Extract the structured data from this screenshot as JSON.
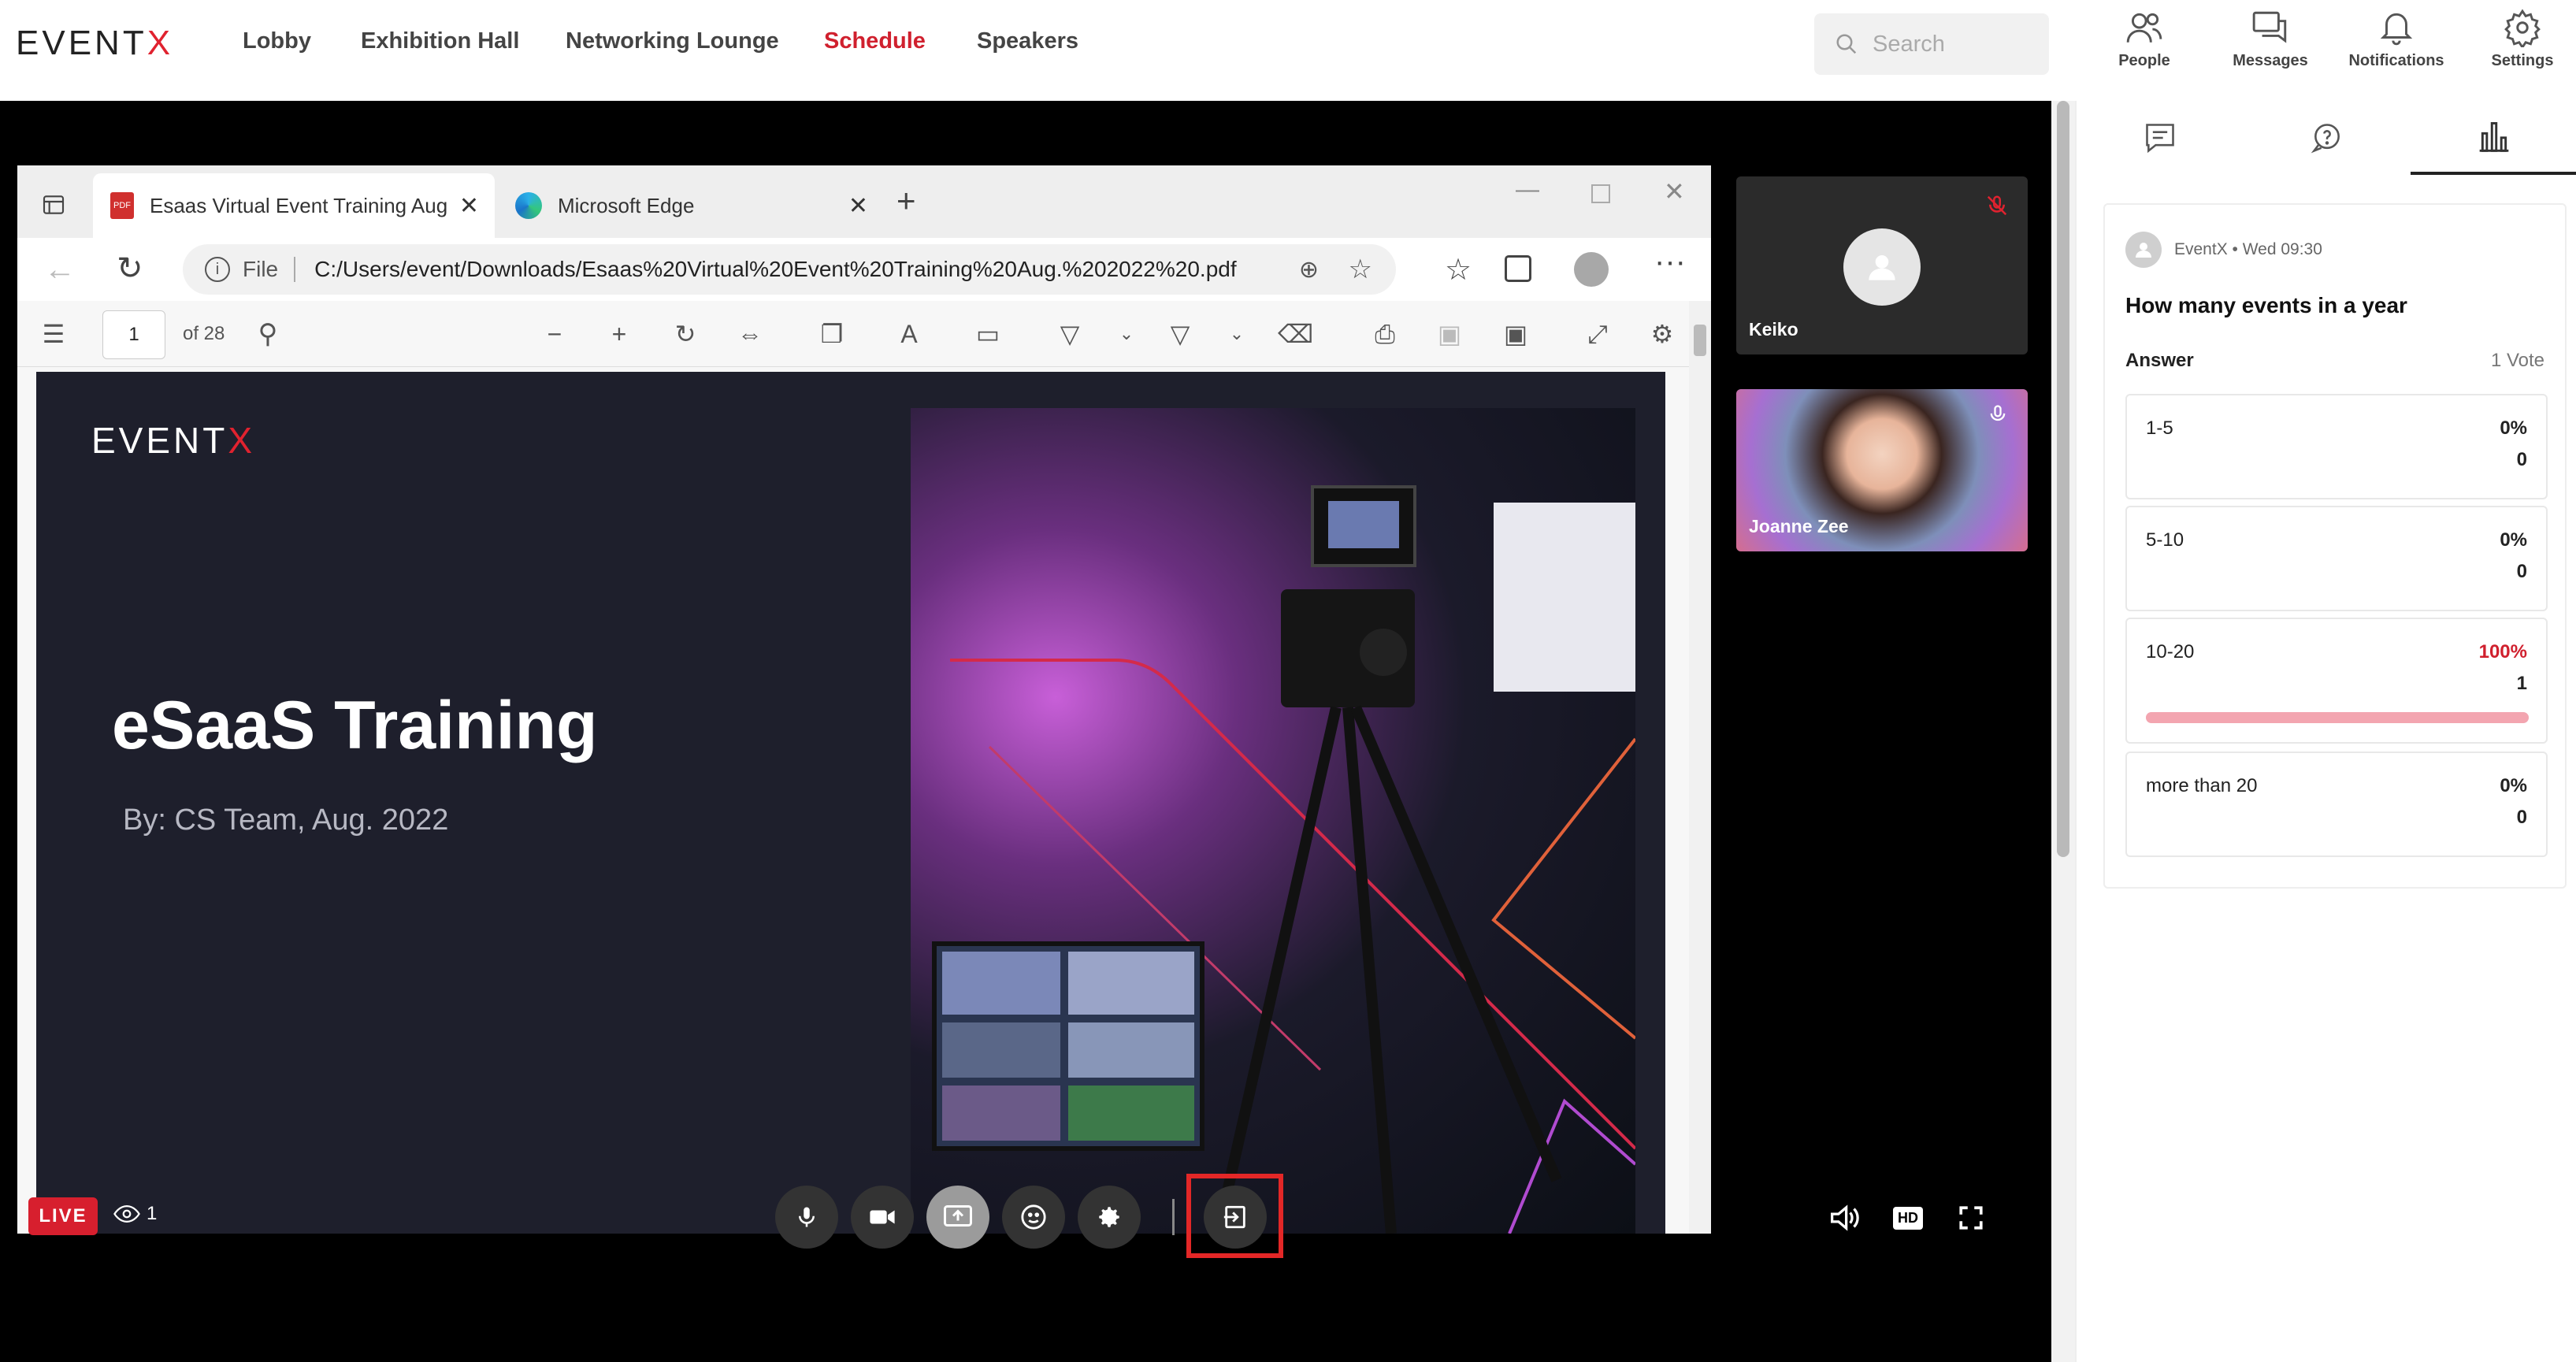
{
  "app": {
    "logo_main": "EVENT",
    "logo_x": "X"
  },
  "nav": {
    "items": [
      {
        "label": "Lobby",
        "active": false
      },
      {
        "label": "Exhibition Hall",
        "active": false
      },
      {
        "label": "Networking Lounge",
        "active": false
      },
      {
        "label": "Schedule",
        "active": true
      },
      {
        "label": "Speakers",
        "active": false
      }
    ],
    "search_placeholder": "Search",
    "icons": [
      {
        "label": "People",
        "icon": "people-icon"
      },
      {
        "label": "Messages",
        "icon": "messages-icon"
      },
      {
        "label": "Notifications",
        "icon": "bell-icon"
      },
      {
        "label": "Settings",
        "icon": "gear-icon"
      }
    ]
  },
  "browser": {
    "tabs": [
      {
        "title": "Esaas Virtual Event Training Aug",
        "active": true
      },
      {
        "title": "Microsoft Edge",
        "active": false
      }
    ],
    "url_prefix": "File",
    "url": "C:/Users/event/Downloads/Esaas%20Virtual%20Event%20Training%20Aug.%202022%20.pdf",
    "page_current": "1",
    "page_total": "of 28"
  },
  "slide": {
    "logo_main": "EVENT",
    "logo_x": "X",
    "title": "eSaaS Training",
    "subtitle": "By: CS Team, Aug. 2022"
  },
  "participants": [
    {
      "name": "Keiko",
      "muted": true
    },
    {
      "name": "Joanne Zee",
      "muted": false
    }
  ],
  "controls": {
    "live_label": "LIVE",
    "viewer_count": "1",
    "hd_label": "HD"
  },
  "poll": {
    "author": "EventX • Wed 09:30",
    "question": "How many events in a year",
    "answer_label": "Answer",
    "vote_count": "1 Vote",
    "options": [
      {
        "label": "1-5",
        "percent": "0%",
        "count": "0",
        "fraction": 0
      },
      {
        "label": "5-10",
        "percent": "0%",
        "count": "0",
        "fraction": 0
      },
      {
        "label": "10-20",
        "percent": "100%",
        "count": "1",
        "fraction": 1
      },
      {
        "label": "more than 20",
        "percent": "0%",
        "count": "0",
        "fraction": 0
      }
    ]
  },
  "colors": {
    "accent": "#d0202e",
    "live": "#d71f2e",
    "poll_bar": "#f3a5b0"
  }
}
